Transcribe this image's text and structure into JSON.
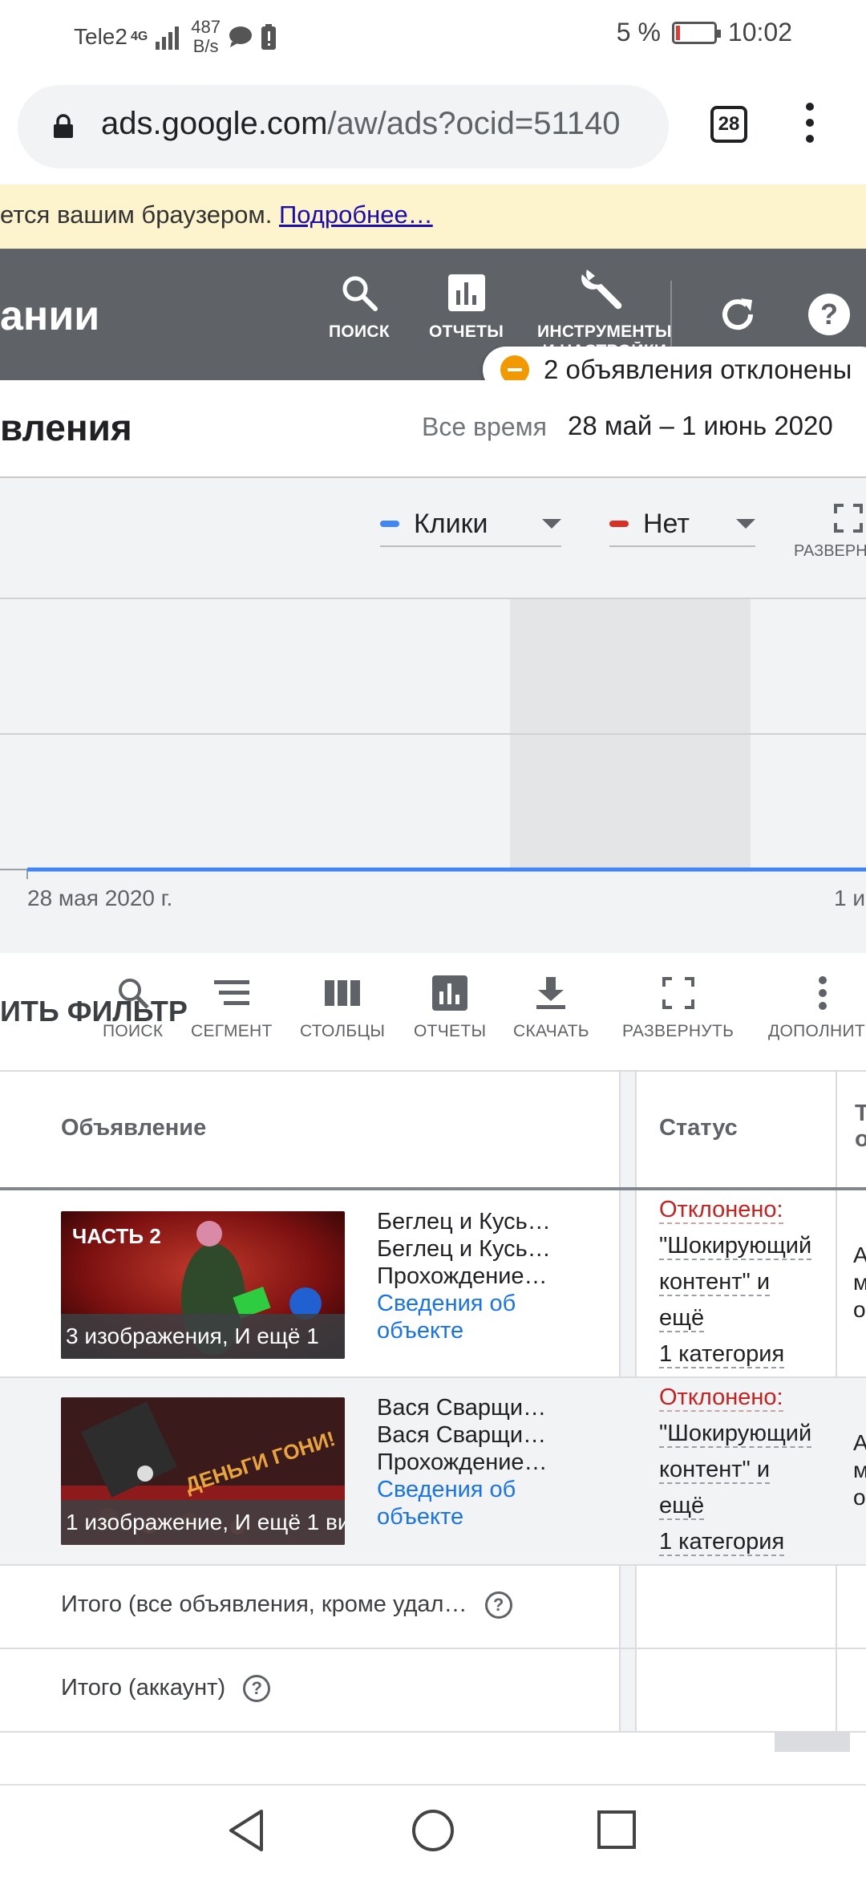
{
  "status_bar": {
    "carrier": "Tele2",
    "network": "4G",
    "speed_value": "487",
    "speed_unit": "B/s",
    "battery": "5 %",
    "time": "10:02"
  },
  "browser": {
    "url_host": "ads.google.com",
    "url_path": "/aw/ads?ocid=51140",
    "tab_count": "28"
  },
  "warning": {
    "text": "ется вашим браузером.",
    "link": "Подробнее…"
  },
  "header": {
    "title": "ании",
    "search_label": "ПОИСК",
    "reports_label": "ОТЧЕТЫ",
    "tools_label_1": "ИНСТРУМЕНТЫ",
    "tools_label_2": "И НАСТРОЙКИ"
  },
  "notice": {
    "text": "2 объявления отклонены"
  },
  "page": {
    "title": "вления",
    "range_label": "Все время",
    "range_value": "28 май – 1 июнь 2020"
  },
  "chart": {
    "metric1": "Клики",
    "metric1_color": "#4285f4",
    "metric2": "Нет",
    "metric2_color": "#d93025",
    "expand_label": "РАЗВЕРН",
    "x_start_label": "28 мая 2020 г.",
    "x_end_label": "1 и"
  },
  "chart_data": {
    "type": "line",
    "series": [
      {
        "name": "Клики",
        "values": [
          0,
          0
        ]
      }
    ],
    "x": [
      "28 мая 2020 г.",
      "1 и"
    ],
    "xlabel": "",
    "ylabel": "",
    "grid": true
  },
  "toolbar": {
    "filter_text": "ИТЬ ФИЛЬТР",
    "search": "ПОИСК",
    "segment": "СЕГМЕНТ",
    "columns": "СТОЛБЦЫ",
    "reports": "ОТЧЕТЫ",
    "download": "СКАЧАТЬ",
    "expand": "РАЗВЕРНУТЬ",
    "more": "ДОПОЛНИТЕ"
  },
  "table": {
    "col_ad": "Объявление",
    "col_status": "Статус",
    "col_next_1": "Т",
    "col_next_2": "о",
    "rows": [
      {
        "thumb_text": "ЧАСТЬ 2",
        "caption": "3 изображения, И ещё 1",
        "line1": "Беглец и Кусь…",
        "line2": "Беглец и Кусь…",
        "line3": "Прохождение…",
        "link1": "Сведения об",
        "link2": "объекте",
        "status1": "Отклонено:",
        "status2": "\"Шокирующий",
        "status3": "контент\" и",
        "status4": "ещё",
        "status5": "1 категория",
        "next1": "А",
        "next2": "м",
        "next3": "о"
      },
      {
        "thumb_text": "ДЕНЬГИ ГОНИ!",
        "caption": "1 изображение, И ещё 1 ви",
        "line1": "Вася Сварщи…",
        "line2": "Вася Сварщи…",
        "line3": "Прохождение…",
        "link1": "Сведения об",
        "link2": "объекте",
        "status1": "Отклонено:",
        "status2": "\"Шокирующий",
        "status3": "контент\" и",
        "status4": "ещё",
        "status5": "1 категория",
        "next1": "А",
        "next2": "м",
        "next3": "о"
      }
    ],
    "total_filtered": "Итого (все объявления, кроме удал…",
    "total_account": "Итого (аккаунт)"
  }
}
